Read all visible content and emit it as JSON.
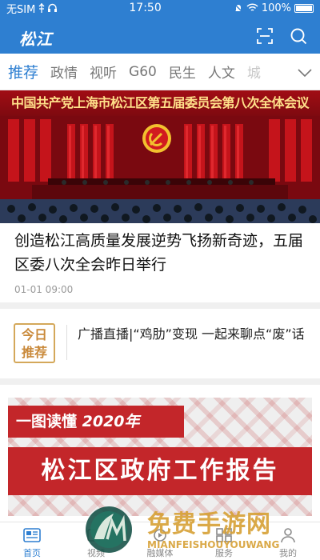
{
  "status_bar": {
    "carrier": "无SIM",
    "time": "17:50",
    "battery": "100%"
  },
  "header": {
    "logo": "松江",
    "icons": [
      "scan-icon",
      "search-icon"
    ]
  },
  "tabs": [
    {
      "label": "推荐",
      "active": true
    },
    {
      "label": "政情",
      "active": false
    },
    {
      "label": "视听",
      "active": false
    },
    {
      "label": "G60",
      "active": false
    },
    {
      "label": "民生",
      "active": false
    },
    {
      "label": "人文",
      "active": false
    },
    {
      "label": "城",
      "active": false
    }
  ],
  "hero": {
    "banner": "中国共产党上海市松江区第五届委员会第八次全体会议"
  },
  "headline": {
    "title": "创造松江高质量发展逆势飞扬新奇迹，五届区委八次全会昨日举行",
    "time": "01-01 09:00"
  },
  "today": {
    "badge_line1": "今日",
    "badge_line2": "推荐",
    "text": "广播直播|“鸡肋”变现 一起来聊点“废”话"
  },
  "report": {
    "line1_prefix": "一图读懂",
    "line1_year": "2020年",
    "line2": "松江区政府工作报告"
  },
  "bottom_nav": [
    {
      "label": "首页",
      "icon": "news-icon",
      "active": true
    },
    {
      "label": "视频",
      "icon": "video-icon",
      "active": false
    },
    {
      "label": "融媒体",
      "icon": "media-icon",
      "active": false
    },
    {
      "label": "服务",
      "icon": "service-icon",
      "active": false
    },
    {
      "label": "我的",
      "icon": "profile-icon",
      "active": false
    }
  ],
  "watermark": {
    "title": "免费手游网",
    "subtitle": "MIANFEISHOUYOUWANG"
  },
  "colors": {
    "brand": "#2e7fd1",
    "hero_red": "#a10d14",
    "report_red": "#c3262a",
    "badge_gold": "#c9893a"
  }
}
